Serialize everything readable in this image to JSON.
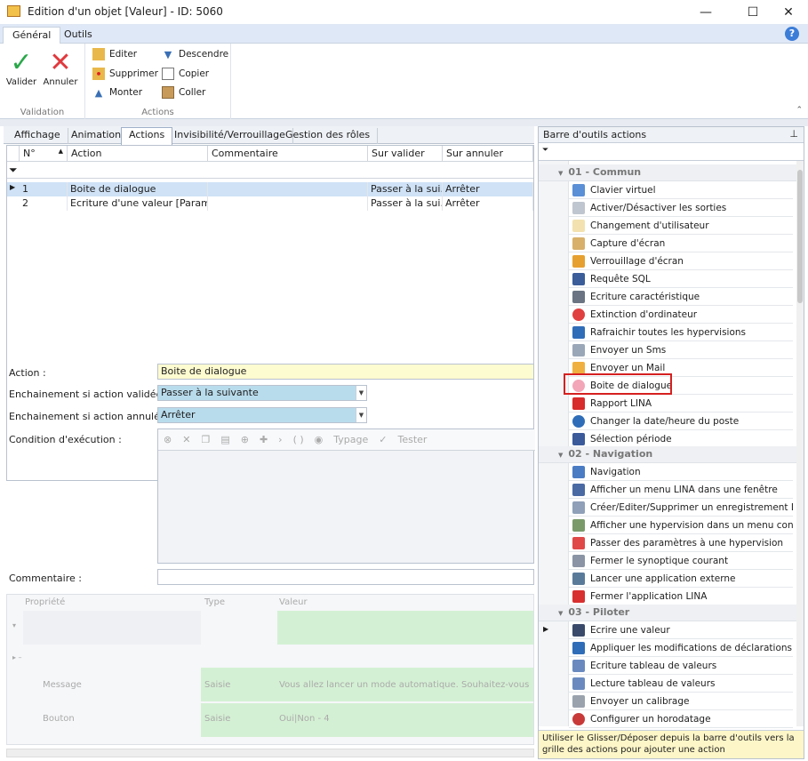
{
  "window": {
    "title": "Edition d'un objet [Valeur] - ID: 5060"
  },
  "ribbon_tabs": [
    "Général",
    "Outils"
  ],
  "ribbon": {
    "validation": {
      "label": "Validation",
      "valider": "Valider",
      "annuler": "Annuler"
    },
    "actions": {
      "label": "Actions",
      "editer": "Editer",
      "supprimer": "Supprimer",
      "monter": "Monter",
      "descendre": "Descendre",
      "copier": "Copier",
      "coller": "Coller"
    }
  },
  "subtabs": [
    "Affichage",
    "Animation",
    "Actions",
    "Invisibilité/Verrouillage",
    "Gestion des rôles"
  ],
  "grid": {
    "columns": [
      "N°",
      "Action",
      "Commentaire",
      "Sur valider",
      "Sur annuler"
    ],
    "rows": [
      {
        "n": "1",
        "action": "Boite de dialogue",
        "commentaire": "",
        "sur_valider": "Passer à la sui…",
        "sur_annuler": "Arrêter"
      },
      {
        "n": "2",
        "action": "Ecriture d'une valeur [Paramèt…",
        "commentaire": "",
        "sur_valider": "Passer à la sui…",
        "sur_annuler": "Arrêter"
      }
    ]
  },
  "form": {
    "action_label": "Action :",
    "action_value": "Boite de dialogue",
    "valid_label": "Enchainement si action validée :",
    "valid_value": "Passer à la suivante",
    "cancel_label": "Enchainement si action annulée :",
    "cancel_value": "Arrêter",
    "condition_label": "Condition d'exécution :",
    "condition_toolbar": {
      "typage": "Typage",
      "tester": "Tester"
    },
    "comment_label": "Commentaire :"
  },
  "properties": {
    "headers": [
      "Propriété",
      "Type",
      "Valeur"
    ],
    "rows": [
      {
        "name": "Message",
        "type": "Saisie",
        "value": "Vous allez lancer un mode automatique. Souhaitez-vous co…"
      },
      {
        "name": "Bouton",
        "type": "Saisie",
        "value": "Oui|Non - 4"
      }
    ]
  },
  "toolbar_panel": {
    "title": "Barre d'outils actions",
    "categories": [
      {
        "name": "01 - Commun",
        "items": [
          "Clavier virtuel",
          "Activer/Désactiver les sorties",
          "Changement d'utilisateur",
          "Capture d'écran",
          "Verrouillage d'écran",
          "Requête SQL",
          "Ecriture caractéristique",
          "Extinction d'ordinateur",
          "Rafraichir toutes les hypervisions",
          "Envoyer un Sms",
          "Envoyer un Mail",
          "Boite de dialogue",
          "Rapport LINA",
          "Changer la date/heure du poste",
          "Sélection période"
        ]
      },
      {
        "name": "02 - Navigation",
        "items": [
          "Navigation",
          "Afficher un menu LINA dans une fenêtre",
          "Créer/Editer/Supprimer un enregistrement LINA",
          "Afficher une hypervision dans un menu context…",
          "Passer des paramètres à une hypervision",
          "Fermer le synoptique courant",
          "Lancer une application externe",
          "Fermer l'application LINA"
        ]
      },
      {
        "name": "03 - Piloter",
        "items": [
          "Ecrire une valeur",
          "Appliquer les modifications de déclarations",
          "Ecriture tableau de valeurs",
          "Lecture tableau de valeurs",
          "Envoyer un calibrage",
          "Configurer un horodatage"
        ]
      }
    ],
    "tip": "Utiliser le Glisser/Déposer depuis la barre d'outils vers la grille des actions pour ajouter une action"
  }
}
